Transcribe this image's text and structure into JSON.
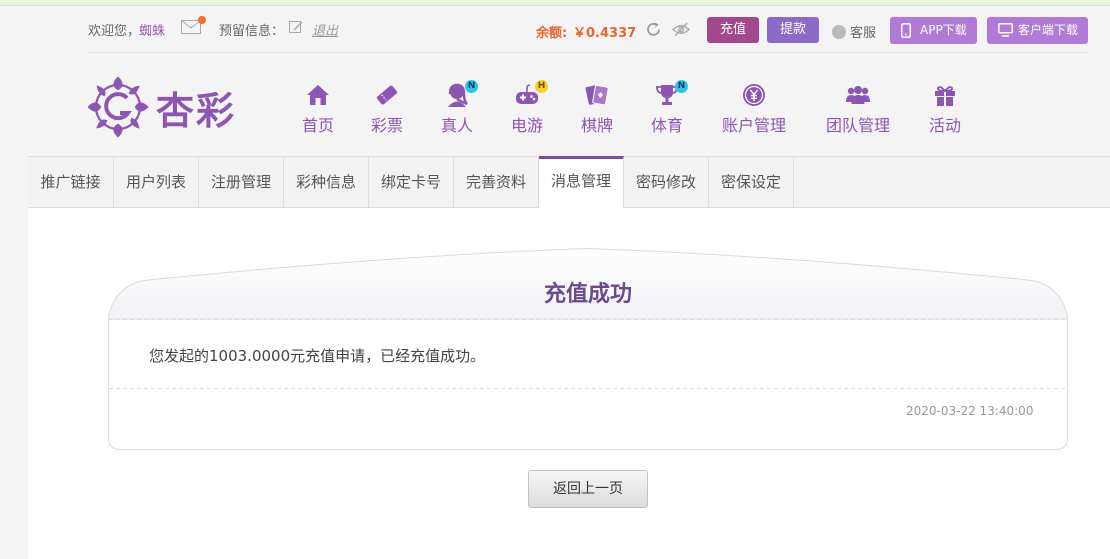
{
  "topbar": {
    "welcome_label": "欢迎您，",
    "username": "蜘蛛",
    "reserve_label": "预留信息：",
    "logout_label": "退出",
    "balance_label": "余额:",
    "balance_value": "￥0.4337",
    "recharge_label": "充值",
    "withdraw_label": "提款",
    "service_label": "客服",
    "app_download_label": "APP下载",
    "client_download_label": "客户端下载"
  },
  "brand": {
    "name": "杏彩",
    "color": "#8e56b3"
  },
  "nav": {
    "items": [
      {
        "label": "首页",
        "icon": "home-icon"
      },
      {
        "label": "彩票",
        "icon": "lottery-icon"
      },
      {
        "label": "真人",
        "icon": "live-dealer-icon",
        "badge": "N"
      },
      {
        "label": "电游",
        "icon": "gamepad-icon",
        "badge": "H"
      },
      {
        "label": "棋牌",
        "icon": "cards-icon"
      },
      {
        "label": "体育",
        "icon": "trophy-icon",
        "badge": "N"
      },
      {
        "label": "账户管理",
        "icon": "account-icon"
      },
      {
        "label": "团队管理",
        "icon": "team-icon"
      },
      {
        "label": "活动",
        "icon": "gift-icon"
      }
    ]
  },
  "subtabs": {
    "items": [
      {
        "label": "推广链接"
      },
      {
        "label": "用户列表"
      },
      {
        "label": "注册管理"
      },
      {
        "label": "彩种信息"
      },
      {
        "label": "绑定卡号"
      },
      {
        "label": "完善资料"
      },
      {
        "label": "消息管理",
        "active": true
      },
      {
        "label": "密码修改"
      },
      {
        "label": "密保设定"
      }
    ]
  },
  "message": {
    "title": "充值成功",
    "body": "您发起的1003.0000元充值申请，已经充值成功。",
    "timestamp": "2020-03-22 13:40:00"
  },
  "actions": {
    "back_label": "返回上一页"
  },
  "colors": {
    "accent": "#8e56b3",
    "recharge": "#a3478f",
    "withdraw": "#8c6bc8",
    "download": "#b07ad6",
    "balance": "#e8662d",
    "badge_new": "#2ec4e8",
    "badge_hot": "#f6d22b"
  }
}
